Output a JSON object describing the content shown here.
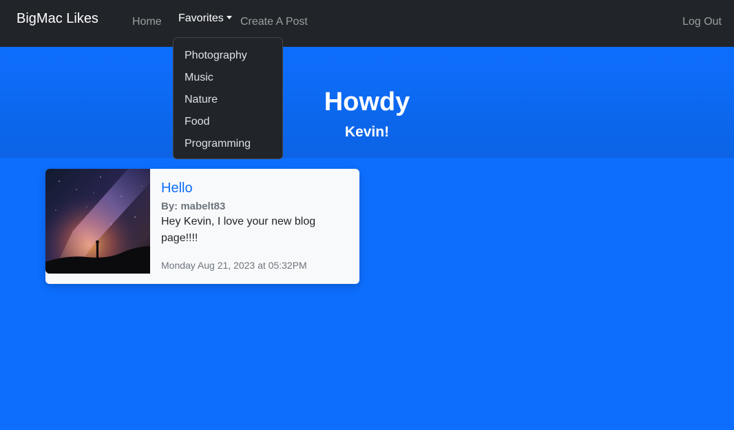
{
  "navbar": {
    "brand": "BigMac Likes",
    "home": "Home",
    "favorites": "Favorites",
    "create": "Create A Post",
    "logout": "Log Out"
  },
  "dropdown": {
    "items": [
      "Photography",
      "Music",
      "Nature",
      "Food",
      "Programming"
    ]
  },
  "hero": {
    "title": "Howdy",
    "subtitle": "Kevin!"
  },
  "post": {
    "title": "Hello",
    "author": "By: mabelt83",
    "body": "Hey Kevin, I love your new blog page!!!!",
    "date": "Monday Aug 21, 2023 at 05:32PM",
    "image": "milky-way-night-sky-silhouette"
  },
  "colors": {
    "primary": "#0d6efd",
    "navbar": "#212529",
    "card": "#f8f9fa"
  }
}
